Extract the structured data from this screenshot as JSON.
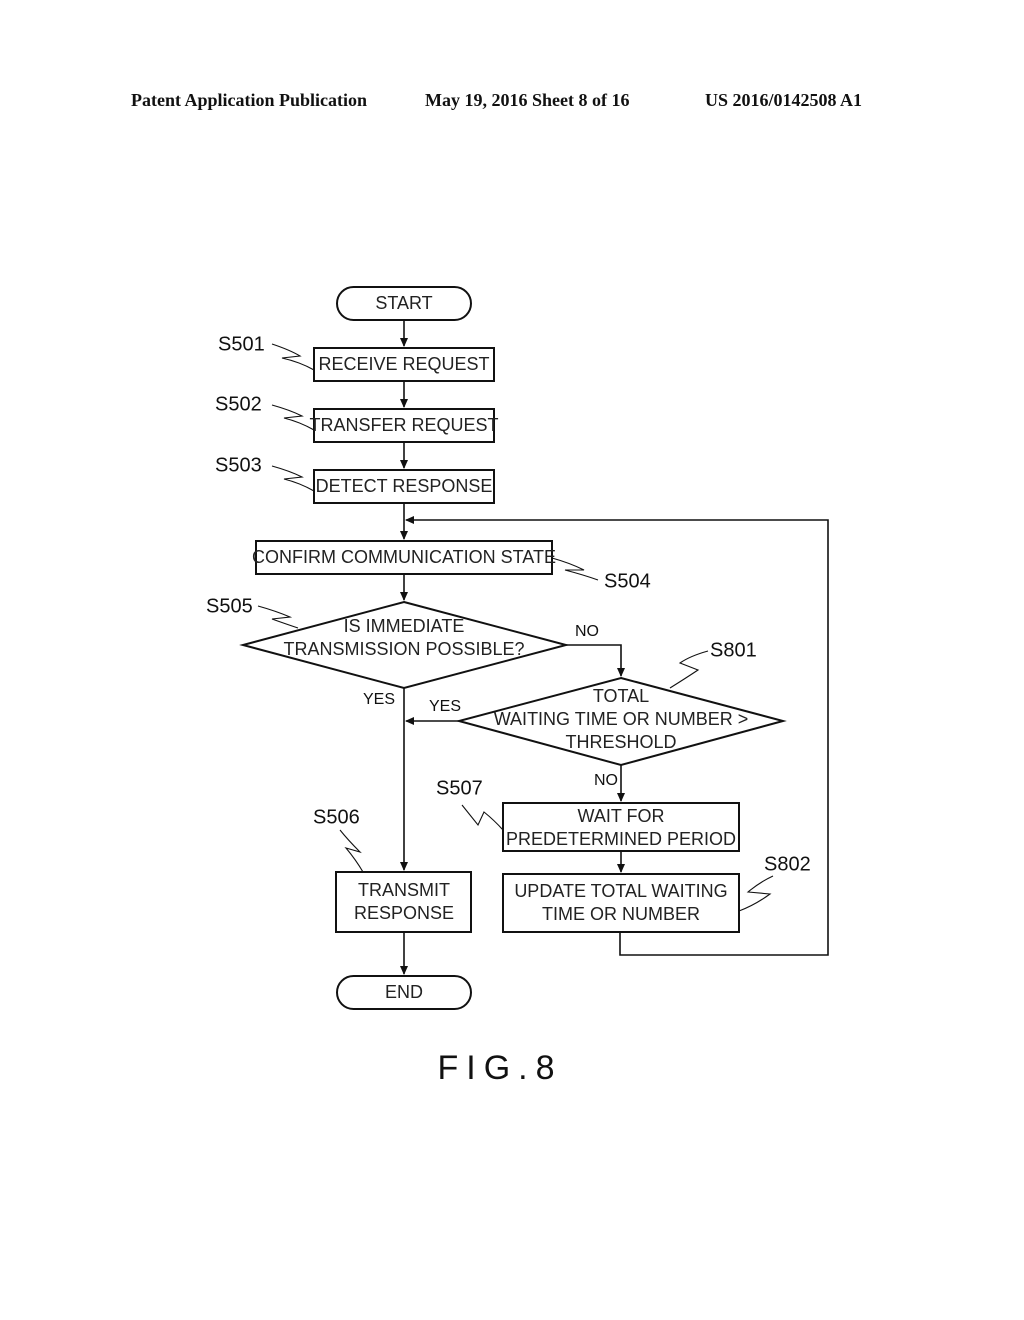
{
  "header": {
    "publication": "Patent Application Publication",
    "date_sheet": "May 19, 2016  Sheet 8 of 16",
    "number": "US 2016/0142508 A1"
  },
  "flowchart": {
    "start": "START",
    "end": "END",
    "steps": {
      "s501": {
        "id": "S501",
        "label": "RECEIVE REQUEST"
      },
      "s502": {
        "id": "S502",
        "label": "TRANSFER REQUEST"
      },
      "s503": {
        "id": "S503",
        "label": "DETECT RESPONSE"
      },
      "s504": {
        "id": "S504",
        "label": "CONFIRM COMMUNICATION STATE"
      },
      "s505": {
        "id": "S505",
        "line1": "IS IMMEDIATE",
        "line2": "TRANSMISSION POSSIBLE?"
      },
      "s801": {
        "id": "S801",
        "line1": "TOTAL",
        "line2": "WAITING TIME OR NUMBER >",
        "line3": "THRESHOLD"
      },
      "s507": {
        "id": "S507",
        "line1": "WAIT FOR",
        "line2": "PREDETERMINED PERIOD"
      },
      "s802": {
        "id": "S802",
        "line1": "UPDATE TOTAL WAITING",
        "line2": "TIME OR NUMBER"
      },
      "s506": {
        "id": "S506",
        "line1": "TRANSMIT",
        "line2": "RESPONSE"
      }
    },
    "branches": {
      "s505_no": "NO",
      "s505_yes": "YES",
      "s801_yes": "YES",
      "s801_no": "NO"
    }
  },
  "figure_label": "FIG.8"
}
